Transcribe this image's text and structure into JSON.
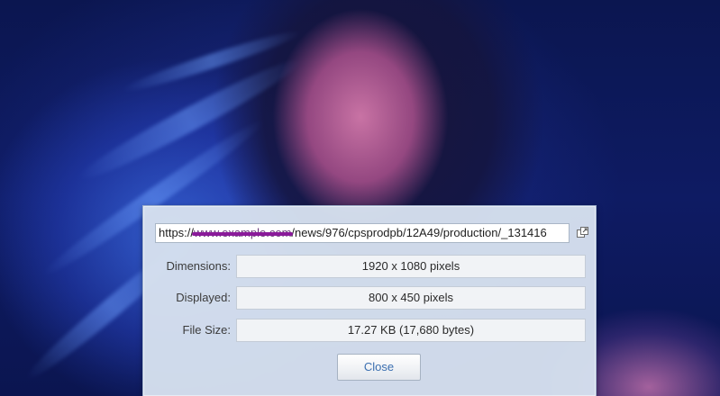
{
  "dialog": {
    "url": {
      "prefix": "https://",
      "redacted": "www.example.com",
      "rest": "/news/976/cpsprodpb/12A49/production/_131416"
    },
    "open_icon": "open-in-new-window-icon",
    "fields": {
      "dimensions": {
        "label": "Dimensions:",
        "value": "1920 x 1080 pixels"
      },
      "displayed": {
        "label": "Displayed:",
        "value": "800 x 450 pixels"
      },
      "file_size": {
        "label": "File Size:",
        "value": "17.27 KB (17,680 bytes)"
      }
    },
    "close_label": "Close"
  },
  "colors": {
    "background": "#0d1a5c",
    "dialog_bg": "#d6e0ee",
    "button_text": "#3b6fb0",
    "redaction": "#8a1a9a"
  }
}
